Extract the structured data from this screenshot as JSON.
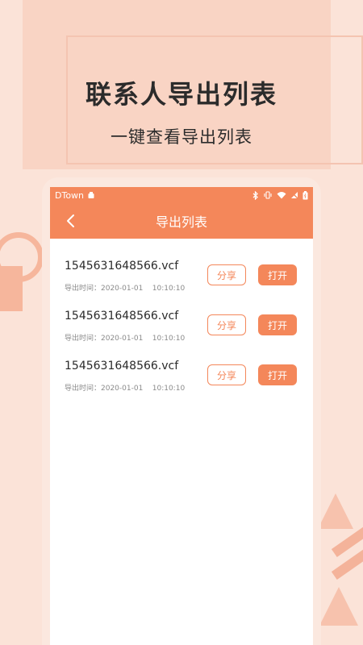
{
  "hero": {
    "title": "联系人导出列表",
    "subtitle": "一键查看导出列表"
  },
  "status_bar": {
    "carrier": "DTown",
    "icons": [
      "app-notification-icon",
      "bluetooth-icon",
      "vibrate-icon",
      "wifi-icon",
      "no-sim-icon",
      "battery-icon"
    ]
  },
  "navbar": {
    "back_icon": "chevron-left-icon",
    "title": "导出列表"
  },
  "files": [
    {
      "name": "1545631648566.vcf",
      "time": "导出时间：2020-01-01    10:10:10",
      "share_label": "分享",
      "open_label": "打开"
    },
    {
      "name": "1545631648566.vcf",
      "time": "导出时间：2020-01-01    10:10:10",
      "share_label": "分享",
      "open_label": "打开"
    },
    {
      "name": "1545631648566.vcf",
      "time": "导出时间：2020-01-01    10:10:10",
      "share_label": "分享",
      "open_label": "打开"
    }
  ],
  "colors": {
    "accent": "#f4875a",
    "background": "#fbe3d8",
    "text": "#2b2b2b",
    "muted": "#8a8a8a"
  }
}
